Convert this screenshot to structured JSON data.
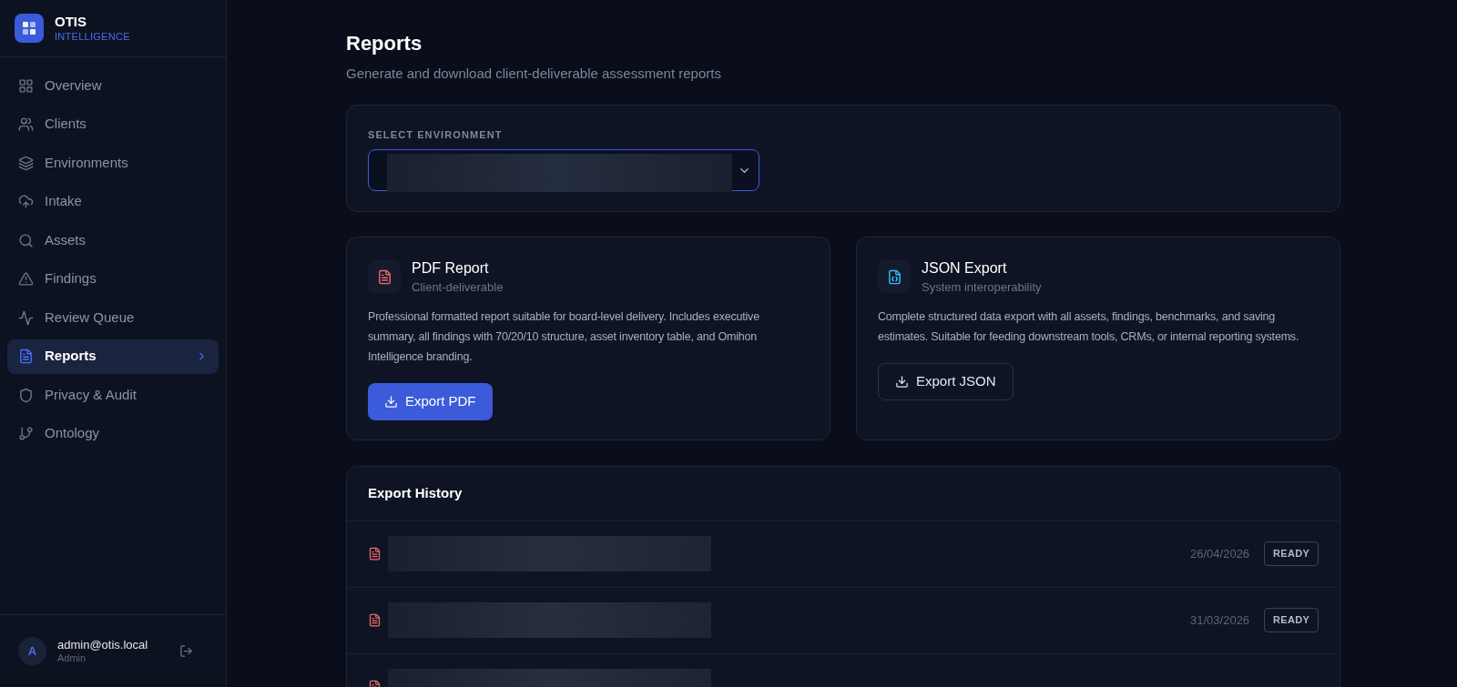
{
  "brand": {
    "name": "OTIS",
    "tagline": "INTELLIGENCE"
  },
  "nav": [
    {
      "label": "Overview",
      "selected": false
    },
    {
      "label": "Clients",
      "selected": false
    },
    {
      "label": "Environments",
      "selected": false
    },
    {
      "label": "Intake",
      "selected": false
    },
    {
      "label": "Assets",
      "selected": false
    },
    {
      "label": "Findings",
      "selected": false
    },
    {
      "label": "Review Queue",
      "selected": false
    },
    {
      "label": "Reports",
      "selected": true
    },
    {
      "label": "Privacy & Audit",
      "selected": false
    },
    {
      "label": "Ontology",
      "selected": false
    }
  ],
  "user": {
    "initial": "A",
    "email": "admin@otis.local",
    "role": "Admin"
  },
  "page": {
    "title": "Reports",
    "subtitle": "Generate and download client-deliverable assessment reports"
  },
  "environment": {
    "label": "SELECT ENVIRONMENT"
  },
  "exports": [
    {
      "kind": "pdf",
      "title": "PDF Report",
      "subtitle": "Client-deliverable",
      "description": "Professional formatted report suitable for board-level delivery. Includes executive summary, all findings with 70/20/10 structure, asset inventory table, and Omihon Intelligence branding.",
      "button": "Export PDF"
    },
    {
      "kind": "json",
      "title": "JSON Export",
      "subtitle": "System interoperability",
      "description": "Complete structured data export with all assets, findings, benchmarks, and saving estimates. Suitable for feeding downstream tools, CRMs, or internal reporting systems.",
      "button": "Export JSON"
    }
  ],
  "history": {
    "title": "Export History",
    "rows": [
      {
        "date": "26/04/2026",
        "status": "READY"
      },
      {
        "date": "31/03/2026",
        "status": "READY"
      },
      {}
    ]
  }
}
